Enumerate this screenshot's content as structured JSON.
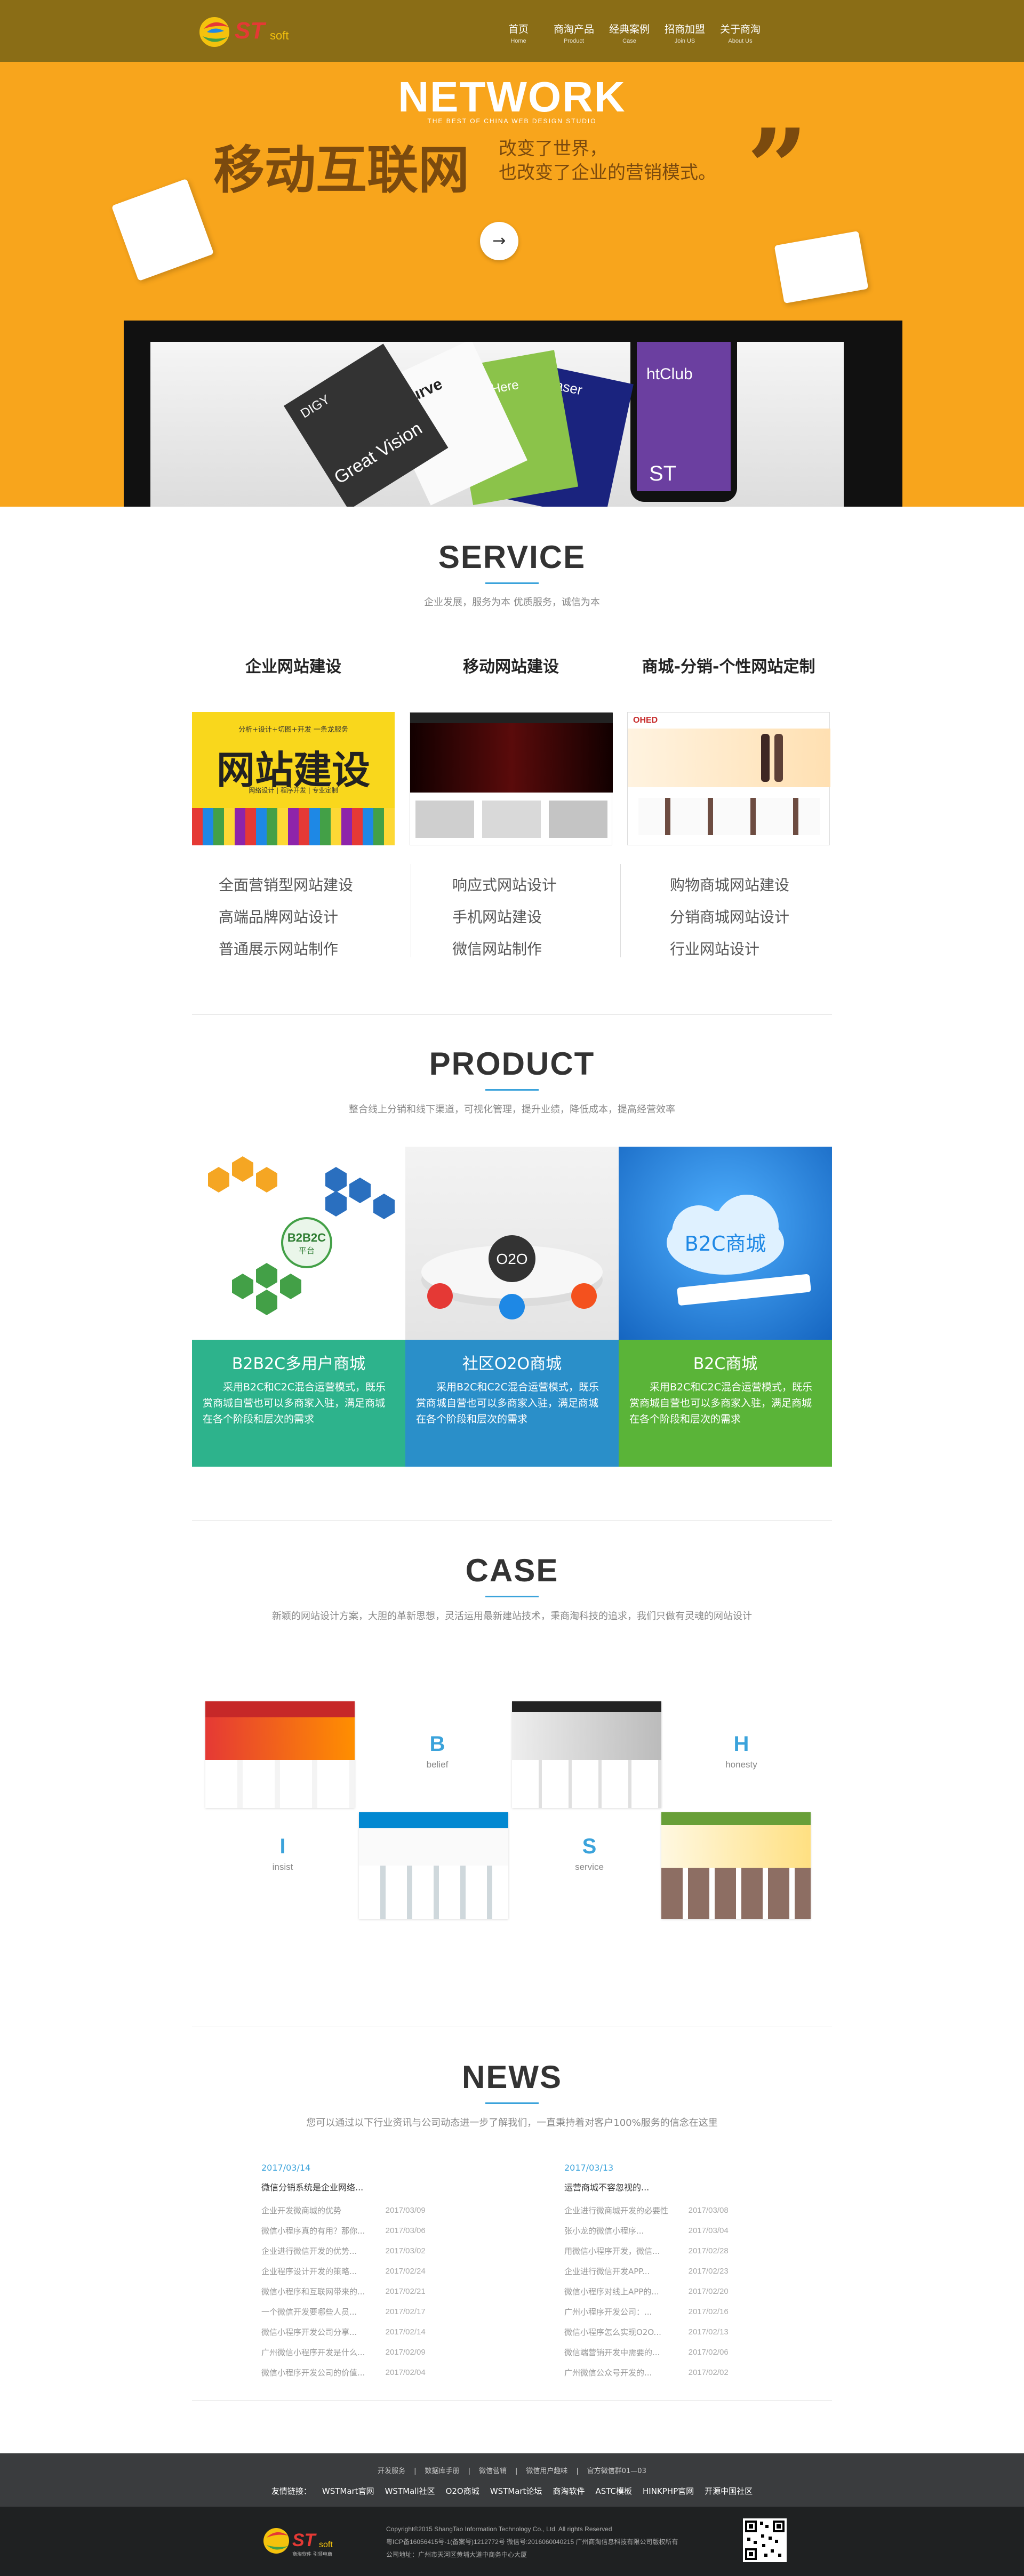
{
  "nav": {
    "items": [
      {
        "zh": "首页",
        "en": "Home"
      },
      {
        "zh": "商淘产品",
        "en": "Product"
      },
      {
        "zh": "经典案例",
        "en": "Case"
      },
      {
        "zh": "招商加盟",
        "en": "Join US"
      },
      {
        "zh": "关于商淘",
        "en": "About Us"
      }
    ]
  },
  "logo": {
    "text": "ST",
    "sub": "soft",
    "caption": "商淘软件 引领电商"
  },
  "banner": {
    "title": "NETWORK",
    "tagline": "THE BEST OF CHINA WEB DESIGN STUDIO",
    "big": "移动互联网",
    "line1": "改变了世界，",
    "line2": "也改变了企业的营销模式。",
    "quote": "”",
    "arrow": "→",
    "colors": {
      "bg": "#f8a51c",
      "text": "#7b4a0e"
    },
    "cards": [
      "DIGY",
      "Curve",
      "Title Here",
      "Teaser",
      "htClub",
      "Great Vision",
      "ST"
    ]
  },
  "service": {
    "title": "SERVICE",
    "subtitle": "企业发展，服务为本   优质服务，诚信为本",
    "columns": [
      {
        "heading": "企业网站建设",
        "image_banner": "网站建设",
        "image_top": "分析+设计+切图+开发 一条龙服务",
        "image_bottom": "网络设计 | 程序开发 | 专业定制",
        "items": [
          "全面营销型网站建设",
          "高端品牌网站设计",
          "普通展示网站制作"
        ]
      },
      {
        "heading": "移动网站建设",
        "items": [
          "响应式网站设计",
          "手机网站建设",
          "微信网站制作"
        ]
      },
      {
        "heading": "商城-分销-个性网站定制",
        "image_logo": "OHED",
        "items": [
          "购物商城网站建设",
          "分销商城网站设计",
          "行业网站设计"
        ]
      }
    ]
  },
  "product": {
    "title": "PRODUCT",
    "subtitle": "整合线上分销和线下渠道，可视化管理，提升业绩，降低成本，提高经营效率",
    "items": [
      {
        "title": "B2B2C多用户商城",
        "desc": "采用B2C和C2C混合运营模式，既乐赏商城自营也可以多商家入驻，满足商城在各个阶段和层次的需求",
        "badge": "B2B2C",
        "badge_sub": "平台",
        "color": "#2db38c"
      },
      {
        "title": "社区O2O商城",
        "desc": "采用B2C和C2C混合运营模式，既乐赏商城自营也可以多商家入驻，满足商城在各个阶段和层次的需求",
        "badge": "O2O",
        "color": "#2a8fc9"
      },
      {
        "title": "B2C商城",
        "desc": "采用B2C和C2C混合运营模式，既乐赏商城自营也可以多商家入驻，满足商城在各个阶段和层次的需求",
        "badge": "B2C商城",
        "color": "#5ab438"
      }
    ]
  },
  "case": {
    "title": "CASE",
    "subtitle": "新颖的网站设计方案，大胆的革新思想，灵活运用最新建站技术，秉商淘科技的追求，我们只做有灵魂的网站设计",
    "cards": [
      {
        "letter": "B",
        "word": "belief"
      },
      {
        "letter": "H",
        "word": "honesty"
      },
      {
        "letter": "I",
        "word": "insist"
      },
      {
        "letter": "S",
        "word": "service"
      }
    ]
  },
  "news": {
    "title": "NEWS",
    "subtitle": "您可以通过以下行业资讯与公司动态进一步了解我们，一直秉持着对客户100%服务的信念在这里",
    "left": {
      "date": "2017/03/14",
      "lead": "微信分销系统是企业网络...",
      "rows": [
        {
          "t": "企业开发微商城的优势",
          "d": "2017/03/09"
        },
        {
          "t": "微信小程序真的有用？那你...",
          "d": "2017/03/06"
        },
        {
          "t": "企业进行微信开发的优势...",
          "d": "2017/03/02"
        },
        {
          "t": "企业程序设计开发的策略...",
          "d": "2017/02/24"
        },
        {
          "t": "微信小程序和互联网带来的...",
          "d": "2017/02/21"
        },
        {
          "t": "一个微信开发要哪些人员...",
          "d": "2017/02/17"
        },
        {
          "t": "微信小程序开发公司分享...",
          "d": "2017/02/14"
        },
        {
          "t": "广州微信小程序开发是什么...",
          "d": "2017/02/09"
        },
        {
          "t": "微信小程序开发公司的价值...",
          "d": "2017/02/04"
        }
      ]
    },
    "right": {
      "date": "2017/03/13",
      "lead": "运营商城不容忽视的...",
      "rows": [
        {
          "t": "企业进行微商城开发的必要性",
          "d": "2017/03/08"
        },
        {
          "t": "张小龙的微信小程序...",
          "d": "2017/03/04"
        },
        {
          "t": "用微信小程序开发，微信...",
          "d": "2017/02/28"
        },
        {
          "t": "企业进行微信开发APP...",
          "d": "2017/02/23"
        },
        {
          "t": "微信小程序对线上APP的...",
          "d": "2017/02/20"
        },
        {
          "t": "广州小程序开发公司：...",
          "d": "2017/02/16"
        },
        {
          "t": "微信小程序怎么实现O2O...",
          "d": "2017/02/13"
        },
        {
          "t": "微信端营销开发中需要的...",
          "d": "2017/02/06"
        },
        {
          "t": "广州微信公众号开发的...",
          "d": "2017/02/02"
        }
      ]
    }
  },
  "footer": {
    "top_links": [
      "开发服务",
      "|",
      "数据库手册",
      "|",
      "微信营销",
      "|",
      "微信用户趣味",
      "|",
      "官方微信群01—03"
    ],
    "bottom_links": [
      "友情链接：",
      "WSTMart官网",
      "WSTMall社区",
      "O2O商城",
      "WSTMart论坛",
      "商淘软件",
      "ASTC模板",
      "HINKPHP官网",
      "开源中国社区"
    ],
    "copyright": "Copyright©2015 ShangTao Information Technology Co., Ltd. All rights Reserved",
    "line2": "粤ICP备16056415号-1(备案号)1212772号   微信号:2016060040215   广州商淘信息科技有限公司版权所有",
    "line3": "公司地址：广州市天河区黄埔大道中商务中心大厦",
    "accent": "#3ba3db"
  }
}
